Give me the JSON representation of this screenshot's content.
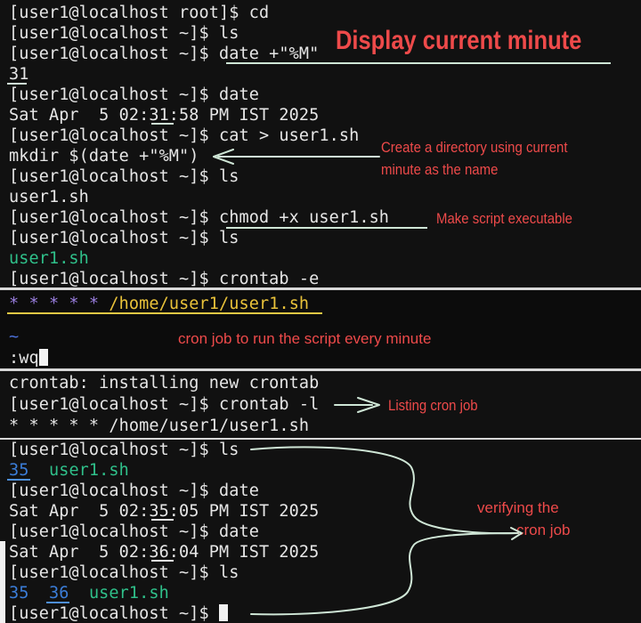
{
  "terminal": {
    "panel1": [
      "[user1@localhost root]$ cd",
      "[user1@localhost ~]$ ls",
      "[user1@localhost ~]$ date +\"%M\"",
      "31",
      "[user1@localhost ~]$ date",
      "Sat Apr  5 02:31:58 PM IST 2025",
      "[user1@localhost ~]$ cat > user1.sh",
      "mkdir $(date +\"%M\")",
      "[user1@localhost ~]$ ls",
      "user1.sh",
      "[user1@localhost ~]$ chmod +x user1.sh",
      "[user1@localhost ~]$ ls",
      "user1.sh",
      "[user1@localhost ~]$ crontab -e"
    ],
    "vim": {
      "stars": "* * * * *",
      "path": "/home/user1/user1.sh",
      "tilde": "~",
      "command": ":wq"
    },
    "panel3": [
      "crontab: installing new crontab",
      "[user1@localhost ~]$ crontab -l",
      "* * * * * /home/user1/user1.sh"
    ],
    "panel4": {
      "prompt_ls_1": "[user1@localhost ~]$ ls",
      "dir_35": "35",
      "script_file": "user1.sh",
      "prompt_date_1": "[user1@localhost ~]$ date",
      "date_output_1": "Sat Apr  5 02:35:05 PM IST 2025",
      "prompt_date_2": "[user1@localhost ~]$ date",
      "date_output_2": "Sat Apr  5 02:36:04 PM IST 2025",
      "prompt_ls_2": "[user1@localhost ~]$ ls",
      "dir_36": "36",
      "final_prompt": "[user1@localhost ~]$ "
    }
  },
  "annotations": {
    "display_minute": "Display current minute",
    "create_directory_line1": "Create a directory using current",
    "create_directory_line2": "minute as the name",
    "make_executable": "Make script executable",
    "cron_every_minute": "cron job to run the script every minute",
    "listing_cron": "Listing cron job",
    "verifying_line1": "verifying the",
    "verifying_line2": "cron job"
  },
  "colors": {
    "terminal_bg": "#111111",
    "text": "#e6e6e6",
    "annotation_red": "#ee4a4a",
    "file_green": "#2fc08a",
    "dir_blue": "#3b7dd8",
    "vim_purple": "#9b7fe0",
    "vim_yellow": "#e9c23a"
  }
}
